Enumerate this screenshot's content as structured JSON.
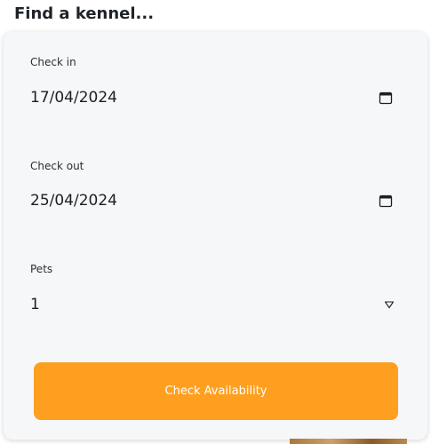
{
  "title": "Find a kennel...",
  "form": {
    "check_in": {
      "label": "Check in",
      "value": "17/04/2024",
      "icon": "calendar-icon"
    },
    "check_out": {
      "label": "Check out",
      "value": "25/04/2024",
      "icon": "calendar-icon"
    },
    "pets": {
      "label": "Pets",
      "value": "1",
      "icon": "dropdown-caret-icon"
    },
    "submit_label": "Check Availability"
  },
  "colors": {
    "accent": "#ff9f1f",
    "card_bg": "#f6f7f9",
    "text": "#1f2328"
  }
}
